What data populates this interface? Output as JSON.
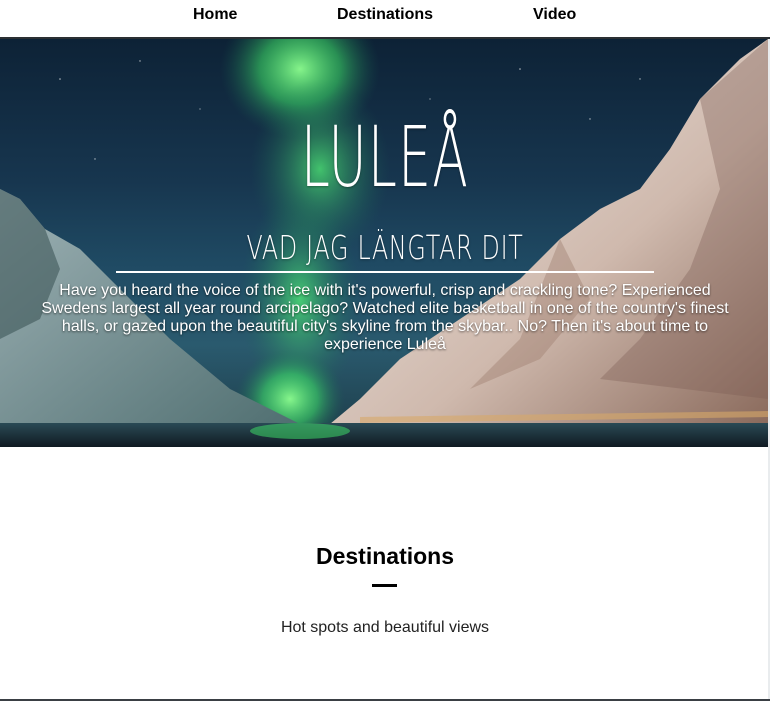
{
  "nav": {
    "items": [
      {
        "label": "Home"
      },
      {
        "label": "Destinations"
      },
      {
        "label": "Video"
      }
    ]
  },
  "hero": {
    "title": "LULEÅ",
    "subtitle": "VAD JAG LÄNGTAR DIT",
    "text": "Have you heard the voice of the ice with it's powerful, crisp and crackling tone? Experienced Swedens largest all year round arcipelago? Watched elite basketball in one of the country's finest halls, or gazed upon the beautiful city's skyline from the skybar.. No? Then it's about time to experience Luleå"
  },
  "destinations": {
    "title": "Destinations",
    "subtitle": "Hot spots and beautiful views"
  },
  "colors": {
    "aurora": "#4cff6a",
    "sky": "#17364f",
    "snow": "#e9e4e2"
  }
}
